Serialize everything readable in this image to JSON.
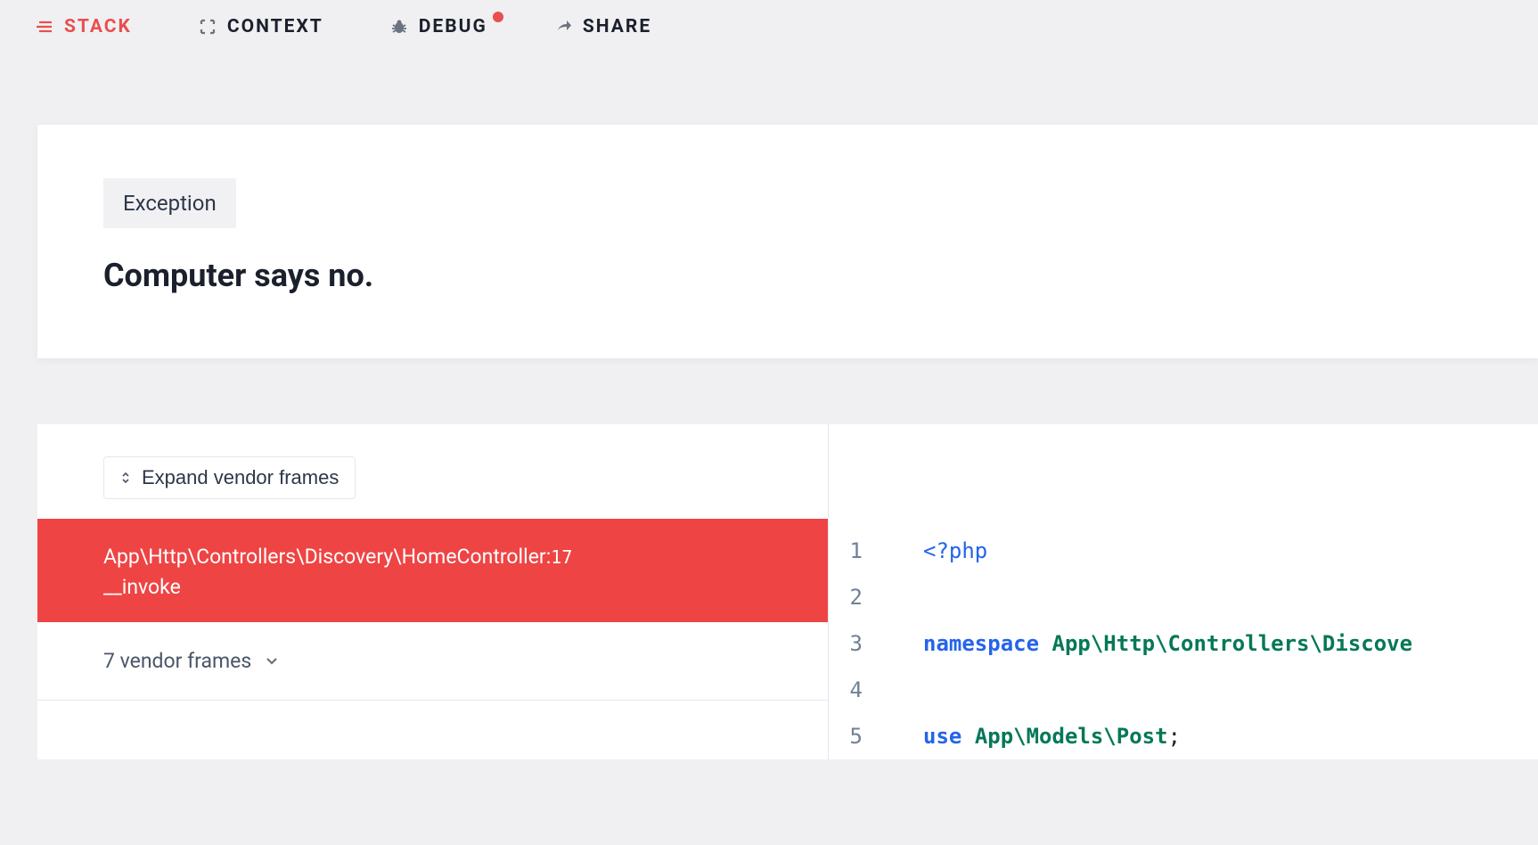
{
  "nav": {
    "stack": "STACK",
    "context": "CONTEXT",
    "debug": "DEBUG",
    "share": "SHARE"
  },
  "exception": {
    "badge": "Exception",
    "title": "Computer says no."
  },
  "stack": {
    "expand_label": "Expand vendor frames",
    "active_frame": {
      "path_prefix": "App\\Http\\Controllers\\Discovery\\HomeController",
      "line": "17",
      "method": "__invoke"
    },
    "vendor_frames_label": "7 vendor frames"
  },
  "code": {
    "lines": [
      {
        "num": "1"
      },
      {
        "num": "2"
      },
      {
        "num": "3"
      },
      {
        "num": "4"
      },
      {
        "num": "5"
      }
    ],
    "line1_open": "<?php",
    "line3_kw": "namespace",
    "line3_ns": "App\\Http\\Controllers\\Discove",
    "line5_kw": "use",
    "line5_ns": "App\\Models\\Post",
    "semicolon": ";"
  }
}
